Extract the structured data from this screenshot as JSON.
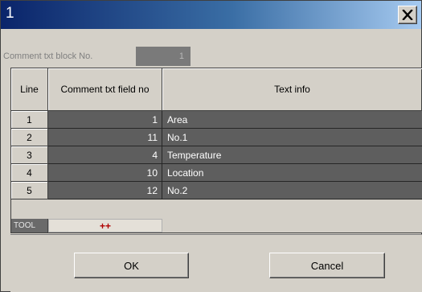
{
  "window": {
    "title": "1",
    "close_icon": "close-x-icon"
  },
  "block": {
    "label": "Comment txt block No.",
    "value": "1"
  },
  "table": {
    "headers": {
      "line": "Line",
      "field": "Comment txt field no",
      "text": "Text info"
    },
    "rows": [
      {
        "line": "1",
        "field": "1",
        "text": " Area"
      },
      {
        "line": "2",
        "field": "11",
        "text": "No.1"
      },
      {
        "line": "3",
        "field": "4",
        "text": "Temperature"
      },
      {
        "line": "4",
        "field": "10",
        "text": "Location"
      },
      {
        "line": "5",
        "field": "12",
        "text": "No.2"
      }
    ],
    "tool": {
      "label": "TOOL",
      "action": "++"
    }
  },
  "buttons": {
    "ok": "OK",
    "cancel": "Cancel"
  },
  "colors": {
    "title_gradient_start": "#0a246a",
    "title_gradient_end": "#a6caf0",
    "cell_dark": "#5e5e5e",
    "tool_action": "#b00000"
  }
}
